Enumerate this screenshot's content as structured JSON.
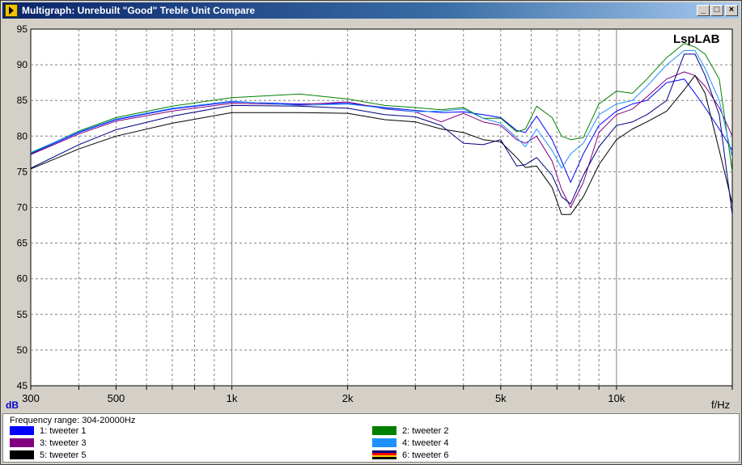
{
  "window": {
    "title": "Multigraph: Unrebuilt \"Good\" Treble Unit Compare",
    "minimize_glyph": "_",
    "maximize_glyph": "□",
    "close_glyph": "×"
  },
  "colors": {
    "background": "#d4d0c8",
    "plot_area": "#ffffff",
    "title_gradient_start": "#0a246a"
  },
  "chart_data": {
    "type": "line",
    "xscale": "log",
    "xlim": [
      300,
      20000
    ],
    "ylim": [
      45,
      95
    ],
    "grid": true,
    "ylabel": "dB",
    "xlabel": "f/Hz",
    "watermark": "LspLAB",
    "yticks": [
      45,
      50,
      55,
      60,
      65,
      70,
      75,
      80,
      85,
      90,
      95
    ],
    "xtick_values": [
      300,
      500,
      1000,
      2000,
      5000,
      10000
    ],
    "xtick_labels": [
      "300",
      "500",
      "1k",
      "2k",
      "5k",
      "10k"
    ],
    "x": [
      300,
      400,
      500,
      700,
      1000,
      1500,
      2000,
      2500,
      3000,
      3500,
      4000,
      4500,
      5000,
      5500,
      5800,
      6200,
      6800,
      7200,
      7600,
      8200,
      9000,
      10000,
      11000,
      12000,
      13500,
      15000,
      16000,
      17000,
      18500,
      20000
    ],
    "series": [
      {
        "name": "1: tweeter 1",
        "color": "#0000ff",
        "values": [
          77.5,
          80.5,
          82.3,
          83.8,
          84.8,
          84.5,
          84.6,
          84.0,
          83.6,
          83.3,
          83.4,
          83.0,
          82.6,
          80.8,
          80.5,
          82.8,
          79.5,
          76.5,
          73.5,
          77.5,
          81.5,
          83.5,
          84.5,
          85.0,
          87.5,
          88.0,
          86.0,
          84.0,
          81.0,
          78.0
        ]
      },
      {
        "name": "2: tweeter 2",
        "color": "#008000",
        "values": [
          77.6,
          80.7,
          82.6,
          84.2,
          85.4,
          85.9,
          85.2,
          84.3,
          84.0,
          83.7,
          84.0,
          82.5,
          82.5,
          80.6,
          81.0,
          84.2,
          82.6,
          80.0,
          79.5,
          79.8,
          84.5,
          86.3,
          86.0,
          88.0,
          91.0,
          93.0,
          92.5,
          91.5,
          88.0,
          75.0
        ]
      },
      {
        "name": "3: tweeter 3",
        "color": "#800080",
        "values": [
          77.4,
          80.3,
          82.1,
          83.5,
          84.6,
          84.4,
          84.8,
          83.8,
          83.4,
          82.0,
          83.2,
          82.0,
          81.5,
          79.5,
          79.0,
          80.0,
          76.5,
          72.5,
          70.0,
          73.5,
          80.5,
          83.0,
          83.8,
          85.5,
          88.0,
          89.0,
          88.5,
          87.0,
          84.0,
          80.0
        ]
      },
      {
        "name": "4: tweeter 4",
        "color": "#1e90ff",
        "values": [
          77.7,
          80.6,
          82.4,
          83.9,
          84.9,
          84.3,
          84.5,
          83.9,
          83.4,
          83.5,
          83.8,
          82.5,
          81.8,
          79.8,
          78.5,
          81.0,
          78.0,
          75.5,
          77.5,
          79.0,
          83.0,
          84.5,
          85.0,
          87.0,
          90.0,
          92.0,
          92.0,
          89.5,
          85.0,
          77.0
        ]
      },
      {
        "name": "5: tweeter 5",
        "color": "#000000",
        "values": [
          75.4,
          78.2,
          80.0,
          81.8,
          83.3,
          83.3,
          83.2,
          82.3,
          82.0,
          81.0,
          80.5,
          79.5,
          79.2,
          77.0,
          75.6,
          75.8,
          72.8,
          69.0,
          69.0,
          71.5,
          76.0,
          79.5,
          81.0,
          82.0,
          83.5,
          86.5,
          88.5,
          86.0,
          78.0,
          70.5
        ]
      },
      {
        "name": "6: tweeter 6",
        "color": "#000080",
        "swatch": "stripes",
        "values": [
          75.5,
          78.8,
          80.9,
          82.8,
          84.3,
          84.2,
          83.9,
          83.0,
          82.7,
          81.5,
          79.0,
          78.8,
          79.5,
          75.8,
          76.0,
          77.0,
          74.5,
          71.5,
          70.5,
          74.5,
          78.5,
          81.5,
          82.0,
          83.0,
          85.0,
          91.5,
          91.5,
          88.5,
          83.0,
          69.0
        ]
      }
    ]
  },
  "legend": {
    "frequency_range": "Frequency range: 304-20000Hz"
  }
}
